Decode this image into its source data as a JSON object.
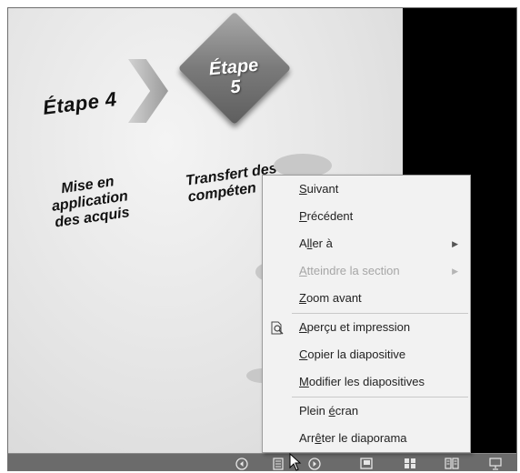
{
  "slide": {
    "step4": "Étape 4",
    "step5_line1": "Étape",
    "step5_line2": "5",
    "step4_caption_lines": [
      "Mise en",
      "application",
      "des acquis"
    ],
    "step5_caption_lines": [
      "Transfert des",
      "compéten"
    ]
  },
  "context_menu": {
    "items": [
      {
        "first": "S",
        "rest": "uivant"
      },
      {
        "first": "P",
        "rest": "récédent"
      },
      {
        "first": "A",
        "mid": "ll",
        "rest": "er à"
      },
      {
        "first": "A",
        "rest": "tteindre la section"
      },
      {
        "first": "Z",
        "rest": "oom avant"
      },
      {
        "first": "A",
        "rest": "perçu et impression"
      },
      {
        "first": "C",
        "rest": "opier la diapositive"
      },
      {
        "first": "M",
        "rest": "odifier les diapositives"
      },
      {
        "pre": "Plein ",
        "first": "é",
        "rest": "cran"
      },
      {
        "pre": "Arr",
        "first": "ê",
        "rest": "ter le diaporama"
      }
    ],
    "labels": [
      "Suivant",
      "Précédent",
      "Aller à",
      "Atteindre la section",
      "Zoom avant",
      "Aperçu et impression",
      "Copier la diapositive",
      "Modifier les diapositives",
      "Plein écran",
      "Arrêter le diaporama"
    ]
  },
  "taskbar": {
    "icons": [
      "previous-icon",
      "menu-icon",
      "next-icon",
      "normal-view-icon",
      "slide-sorter-icon",
      "reading-view-icon",
      "slideshow-icon"
    ]
  },
  "colors": {
    "menu_bg": "#f2f2f2",
    "taskbar_bg": "#6b6b6b",
    "disabled_text": "#a6a6a6"
  }
}
